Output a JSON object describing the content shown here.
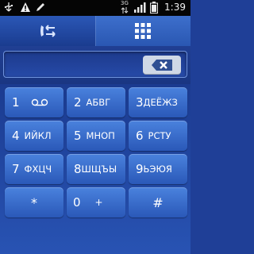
{
  "status_bar": {
    "icons": [
      "usb-icon",
      "warning-icon",
      "pen-icon"
    ],
    "network": "3G",
    "time": "1:39"
  },
  "tabs": [
    {
      "name": "call-log-tab",
      "icon": "call-log-icon",
      "selected": false
    },
    {
      "name": "dialpad-tab",
      "icon": "dialpad-grid-icon",
      "selected": true
    }
  ],
  "input": {
    "value": ""
  },
  "keys": [
    {
      "digit": "1",
      "letters": "",
      "icon": "voicemail-icon"
    },
    {
      "digit": "2",
      "letters": "АБВГ"
    },
    {
      "digit": "3",
      "letters": "ДЕЁЖЗ"
    },
    {
      "digit": "4",
      "letters": "ИЙКЛ"
    },
    {
      "digit": "5",
      "letters": "МНОП"
    },
    {
      "digit": "6",
      "letters": "РСТУ"
    },
    {
      "digit": "7",
      "letters": "ФХЦЧ"
    },
    {
      "digit": "8",
      "letters": "ШЩЪЫ"
    },
    {
      "digit": "9",
      "letters": "ЬЭЮЯ"
    },
    {
      "digit": "*",
      "letters": ""
    },
    {
      "digit": "0",
      "letters": "+"
    },
    {
      "digit": "#",
      "letters": ""
    }
  ],
  "colors": {
    "background": "#1f3f97",
    "key": "#3d72d0",
    "accent": "#6f93de"
  }
}
